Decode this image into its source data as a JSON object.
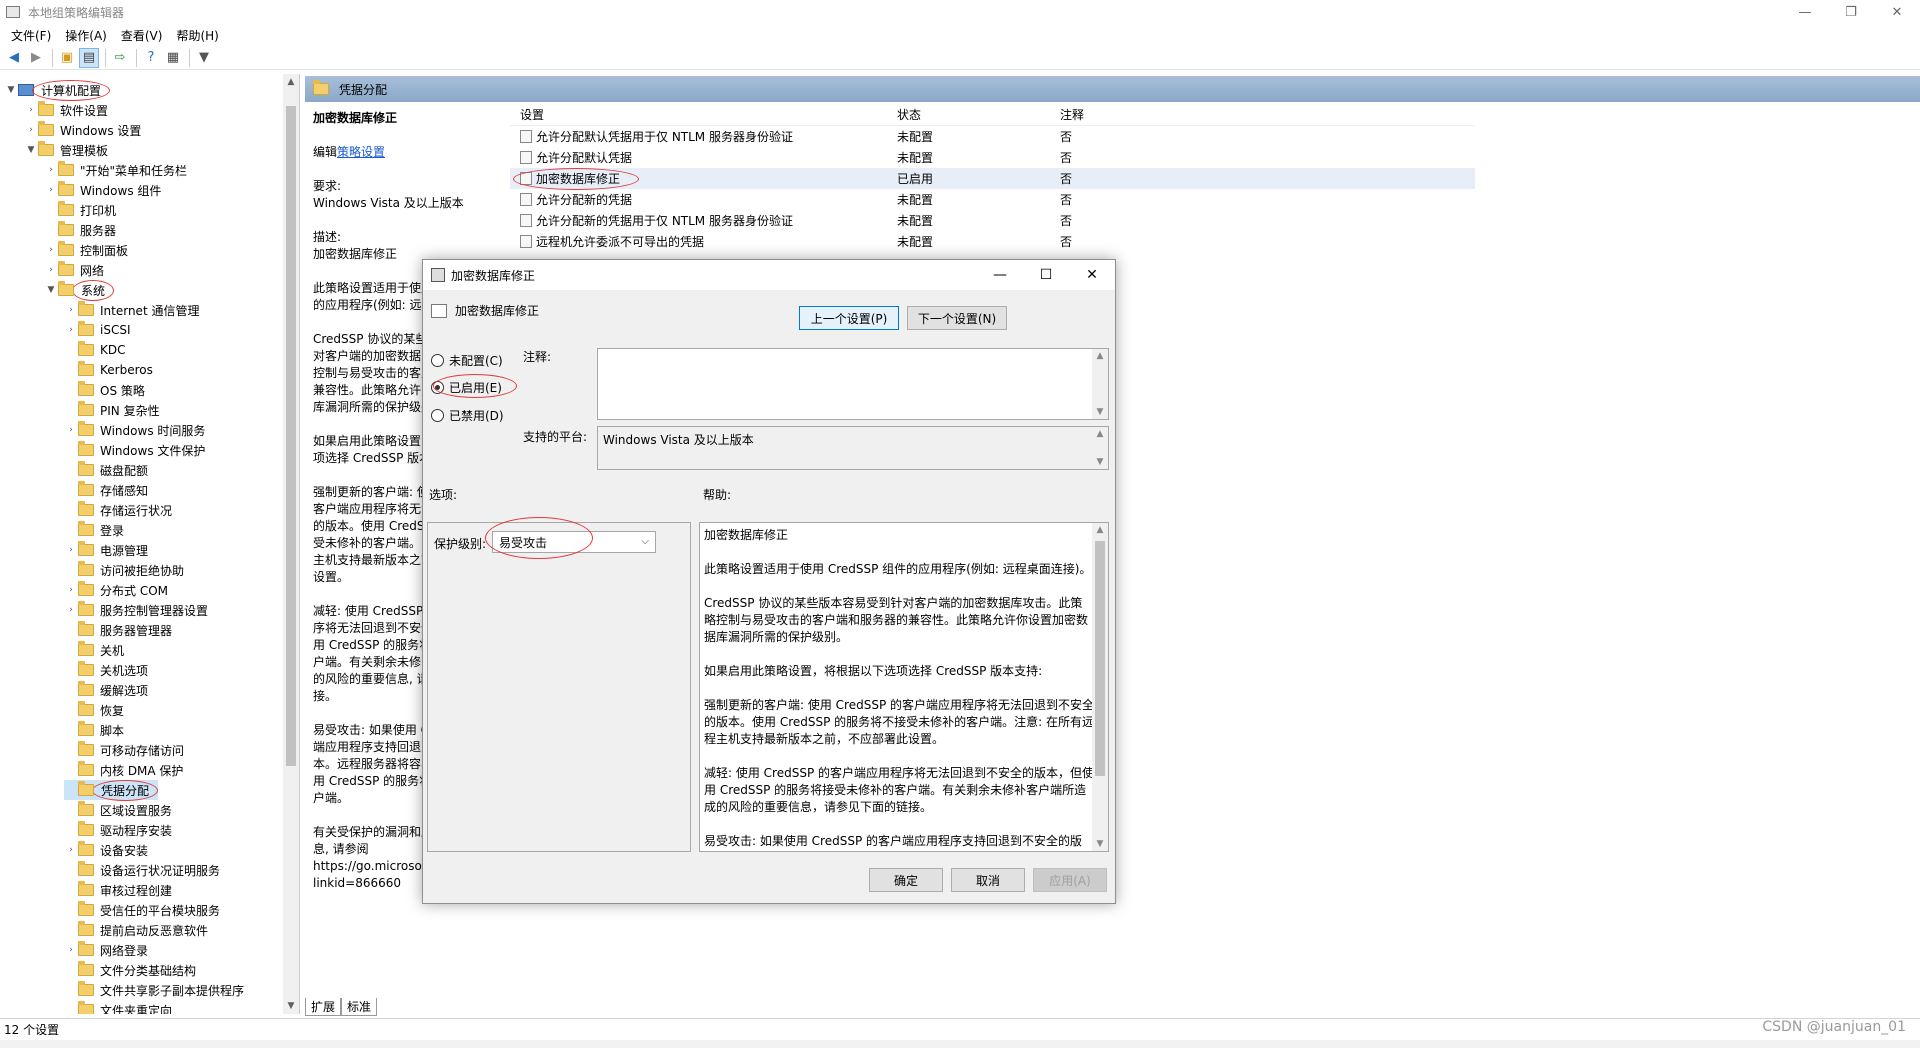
{
  "window": {
    "title": "本地组策略编辑器"
  },
  "menu": [
    "文件(F)",
    "操作(A)",
    "查看(V)",
    "帮助(H)"
  ],
  "tree": [
    {
      "label": "计算机配置",
      "level": 0,
      "exp": "▼",
      "type": "pc",
      "circled": true
    },
    {
      "label": "软件设置",
      "level": 1,
      "exp": "›"
    },
    {
      "label": "Windows 设置",
      "level": 1,
      "exp": "›"
    },
    {
      "label": "管理模板",
      "level": 1,
      "exp": "▼"
    },
    {
      "label": "\"开始\"菜单和任务栏",
      "level": 2,
      "exp": "›"
    },
    {
      "label": "Windows 组件",
      "level": 2,
      "exp": "›"
    },
    {
      "label": "打印机",
      "level": 2,
      "exp": ""
    },
    {
      "label": "服务器",
      "level": 2,
      "exp": ""
    },
    {
      "label": "控制面板",
      "level": 2,
      "exp": "›"
    },
    {
      "label": "网络",
      "level": 2,
      "exp": "›"
    },
    {
      "label": "系统",
      "level": 2,
      "exp": "▼",
      "circled": true
    },
    {
      "label": "Internet 通信管理",
      "level": 3,
      "exp": "›"
    },
    {
      "label": "iSCSI",
      "level": 3,
      "exp": "›"
    },
    {
      "label": "KDC",
      "level": 3,
      "exp": ""
    },
    {
      "label": "Kerberos",
      "level": 3,
      "exp": ""
    },
    {
      "label": "OS 策略",
      "level": 3,
      "exp": ""
    },
    {
      "label": "PIN 复杂性",
      "level": 3,
      "exp": ""
    },
    {
      "label": "Windows 时间服务",
      "level": 3,
      "exp": "›"
    },
    {
      "label": "Windows 文件保护",
      "level": 3,
      "exp": ""
    },
    {
      "label": "磁盘配额",
      "level": 3,
      "exp": ""
    },
    {
      "label": "存储感知",
      "level": 3,
      "exp": ""
    },
    {
      "label": "存储运行状况",
      "level": 3,
      "exp": ""
    },
    {
      "label": "登录",
      "level": 3,
      "exp": ""
    },
    {
      "label": "电源管理",
      "level": 3,
      "exp": "›"
    },
    {
      "label": "访问被拒绝协助",
      "level": 3,
      "exp": ""
    },
    {
      "label": "分布式 COM",
      "level": 3,
      "exp": "›"
    },
    {
      "label": "服务控制管理器设置",
      "level": 3,
      "exp": "›"
    },
    {
      "label": "服务器管理器",
      "level": 3,
      "exp": ""
    },
    {
      "label": "关机",
      "level": 3,
      "exp": ""
    },
    {
      "label": "关机选项",
      "level": 3,
      "exp": ""
    },
    {
      "label": "缓解选项",
      "level": 3,
      "exp": ""
    },
    {
      "label": "恢复",
      "level": 3,
      "exp": ""
    },
    {
      "label": "脚本",
      "level": 3,
      "exp": ""
    },
    {
      "label": "可移动存储访问",
      "level": 3,
      "exp": ""
    },
    {
      "label": "内核 DMA 保护",
      "level": 3,
      "exp": ""
    },
    {
      "label": "凭据分配",
      "level": 3,
      "exp": "",
      "circled": true,
      "selected": true
    },
    {
      "label": "区域设置服务",
      "level": 3,
      "exp": ""
    },
    {
      "label": "驱动程序安装",
      "level": 3,
      "exp": ""
    },
    {
      "label": "设备安装",
      "level": 3,
      "exp": "›"
    },
    {
      "label": "设备运行状况证明服务",
      "level": 3,
      "exp": ""
    },
    {
      "label": "审核过程创建",
      "level": 3,
      "exp": ""
    },
    {
      "label": "受信任的平台模块服务",
      "level": 3,
      "exp": ""
    },
    {
      "label": "提前启动反恶意软件",
      "level": 3,
      "exp": ""
    },
    {
      "label": "网络登录",
      "level": 3,
      "exp": "›"
    },
    {
      "label": "文件分类基础结构",
      "level": 3,
      "exp": ""
    },
    {
      "label": "文件共享影子副本提供程序",
      "level": 3,
      "exp": ""
    },
    {
      "label": "文件夹重定向",
      "level": 3,
      "exp": ""
    }
  ],
  "header": {
    "title": "凭据分配"
  },
  "desc": {
    "title": "加密数据库修正",
    "edit_prefix": "编辑",
    "edit_link": "策略设置",
    "req_label": "要求:",
    "req_value": "Windows Vista 及以上版本",
    "desc_label": "描述:",
    "desc_value": "加密数据库修正",
    "lines": [
      "此策略设置适用于使用",
      "的应用程序(例如: 远程",
      "",
      "CredSSP 协议的某些",
      "对客户端的加密数据",
      "控制与易受攻击的客户",
      "兼容性。此策略允许",
      "库漏洞所需的保护级别",
      "",
      "如果启用此策略设置",
      "项选择 CredSSP 版本",
      "",
      "强制更新的客户端: 使",
      "客户端应用程序将无法",
      "的版本。使用 CredS",
      "受未修补的客户端。",
      "主机支持最新版本之前",
      "设置。",
      "",
      "减轻: 使用 CredSSP",
      "序将无法回退到不安全",
      "用 CredSSP 的服务将",
      "户端。有关剩余未修",
      "的风险的重要信息, 请",
      "接。",
      "",
      "易受攻击: 如果使用 C",
      "端应用程序支持回退到",
      "本。远程服务器将容易",
      "用 CredSSP 的服务将",
      "户端。",
      "",
      "有关受保护的漏洞和股",
      "息, 请参阅",
      "https://go.microsof",
      "linkid=866660"
    ]
  },
  "grid": {
    "headers": [
      "设置",
      "状态",
      "注释"
    ],
    "rows": [
      {
        "name": "允许分配默认凭据用于仅 NTLM 服务器身份验证",
        "state": "未配置",
        "note": "否"
      },
      {
        "name": "允许分配默认凭据",
        "state": "未配置",
        "note": "否"
      },
      {
        "name": "加密数据库修正",
        "state": "已启用",
        "note": "否",
        "selected": true
      },
      {
        "name": "允许分配新的凭据",
        "state": "未配置",
        "note": "否"
      },
      {
        "name": "允许分配新的凭据用于仅 NTLM 服务器身份验证",
        "state": "未配置",
        "note": "否"
      },
      {
        "name": "远程机允许委派不可导出的凭据",
        "state": "未配置",
        "note": "否"
      }
    ]
  },
  "tabs": [
    "扩展",
    "标准"
  ],
  "status": {
    "text": "12 个设置"
  },
  "watermark": "CSDN @juanjuan_01",
  "dialog": {
    "title": "加密数据库修正",
    "subtitle": "加密数据库修正",
    "prev_btn": "上一个设置(P)",
    "next_btn": "下一个设置(N)",
    "radio_not_configured": "未配置(C)",
    "radio_enabled": "已启用(E)",
    "radio_disabled": "已禁用(D)",
    "comment_label": "注释:",
    "platform_label": "支持的平台:",
    "platform_value": "Windows Vista 及以上版本",
    "options_label": "选项:",
    "help_label": "帮助:",
    "protect_label": "保护级别:",
    "protect_value": "易受攻击",
    "help_paragraphs": [
      "加密数据库修正",
      "此策略设置适用于使用 CredSSP 组件的应用程序(例如: 远程桌面连接)。",
      "CredSSP 协议的某些版本容易受到针对客户端的加密数据库攻击。此策略控制与易受攻击的客户端和服务器的兼容性。此策略允许你设置加密数据库漏洞所需的保护级别。",
      "如果启用此策略设置，将根据以下选项选择 CredSSP 版本支持:",
      "强制更新的客户端: 使用 CredSSP 的客户端应用程序将无法回退到不安全的版本。使用 CredSSP 的服务将不接受未修补的客户端。注意: 在所有远程主机支持最新版本之前，不应部署此设置。",
      "减轻: 使用 CredSSP 的客户端应用程序将无法回退到不安全的版本，但使用 CredSSP 的服务将接受未修补的客户端。有关剩余未修补客户端所造成的风险的重要信息，请参见下面的链接。",
      "易受攻击: 如果使用 CredSSP 的客户端应用程序支持回退到不安全的版本，远程服务器将容易受到攻击。使用 CredSSP 的服务将接受未修补的客户端。"
    ],
    "ok_btn": "确定",
    "cancel_btn": "取消",
    "apply_btn": "应用(A)"
  }
}
